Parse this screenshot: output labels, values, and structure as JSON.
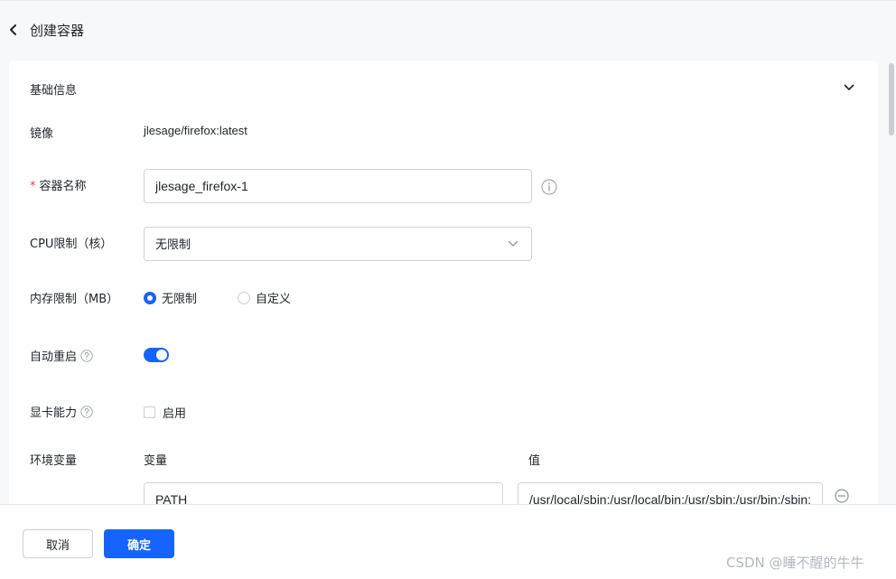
{
  "header": {
    "title": "创建容器",
    "back_icon": "chevron-left-icon"
  },
  "section": {
    "title": "基础信息",
    "collapse_icon": "chevron-down-icon"
  },
  "form": {
    "image": {
      "label": "镜像",
      "value": "jlesage/firefox:latest"
    },
    "container_name": {
      "required_mark": "*",
      "label": "容器名称",
      "value": "jlesage_firefox-1",
      "info_icon": "info-icon"
    },
    "cpu_limit": {
      "label": "CPU限制（核）",
      "selected": "无限制"
    },
    "memory_limit": {
      "label": "内存限制（MB）",
      "options": [
        {
          "label": "无限制",
          "checked": true
        },
        {
          "label": "自定义",
          "checked": false
        }
      ]
    },
    "auto_restart": {
      "label": "自动重启",
      "enabled": true,
      "help_icon": "question-circle-icon"
    },
    "gpu": {
      "label": "显卡能力",
      "checkbox_label": "启用",
      "checked": false,
      "help_icon": "question-circle-icon"
    },
    "env": {
      "label": "环境变量",
      "col_name": "变量",
      "col_value": "值",
      "rows": [
        {
          "name": "PATH",
          "value": "/usr/local/sbin:/usr/local/bin:/usr/sbin:/usr/bin:/sbin:"
        }
      ]
    }
  },
  "footer": {
    "cancel_label": "取消",
    "confirm_label": "确定",
    "watermark": "CSDN @睡不醒的牛牛"
  },
  "colors": {
    "primary": "#1664ff",
    "required": "#f53f3f",
    "border": "#d0d3d9"
  }
}
